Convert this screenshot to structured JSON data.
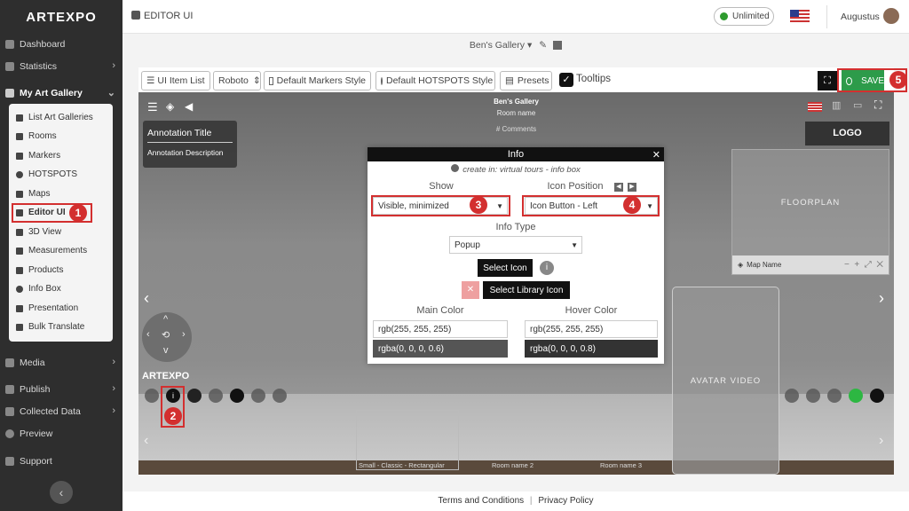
{
  "sidebar": {
    "logo": "ARTEXPO",
    "items": [
      {
        "label": "Dashboard",
        "icon": "dashboard-icon"
      },
      {
        "label": "Statistics",
        "icon": "chart-icon"
      },
      {
        "label": "My Art Gallery",
        "icon": "gallery-icon"
      },
      {
        "label": "Media",
        "icon": "media-icon"
      },
      {
        "label": "Publish",
        "icon": "publish-icon"
      },
      {
        "label": "Collected Data",
        "icon": "database-icon"
      },
      {
        "label": "Preview",
        "icon": "eye-icon"
      },
      {
        "label": "Support",
        "icon": "support-icon"
      }
    ],
    "subitems": [
      "List Art Galleries",
      "Rooms",
      "Markers",
      "HOTSPOTS",
      "Maps",
      "Editor UI",
      "3D View",
      "Measurements",
      "Products",
      "Info Box",
      "Presentation",
      "Bulk Translate"
    ]
  },
  "header": {
    "title": "EDITOR UI",
    "status": "Unlimited",
    "user": "Augustus",
    "status_color": "#2e9b2e"
  },
  "subheader": {
    "gallery": "Ben's Gallery"
  },
  "toolbar": {
    "ui_item_list": "UI Item List",
    "font": "Roboto",
    "markers_style": "Default Markers Style",
    "hotspots_style": "Default HOTSPOTS Style",
    "presets": "Presets",
    "tooltips": "Tooltips",
    "save": "SAVE"
  },
  "viewer": {
    "gallery_name": "Ben's Gallery",
    "room_name": "Room name",
    "comments": "# Comments",
    "annotation_title": "Annotation Title",
    "annotation_desc": "Annotation Description",
    "logo": "LOGO",
    "floorplan": "FLOORPLAN",
    "map_name": "Map Name",
    "avatar_video": "AVATAR VIDEO",
    "brand": "ARTEXPO",
    "rooms": [
      "Small - Classic - Rectangular",
      "Room name 2",
      "Room name 3"
    ]
  },
  "dialog": {
    "title": "Info",
    "hint": "create in: virtual tours - info box",
    "show_label": "Show",
    "show_value": "Visible, minimized",
    "icon_pos_label": "Icon Position",
    "icon_pos_value": "Icon Button - Left",
    "info_type_label": "Info Type",
    "info_type_value": "Popup",
    "select_icon": "Select Icon",
    "select_library_icon": "Select Library Icon",
    "main_color_label": "Main Color",
    "hover_color_label": "Hover Color",
    "main_color_1": "rgb(255, 255, 255)",
    "main_color_2": "rgba(0, 0, 0, 0.6)",
    "hover_color_1": "rgb(255, 255, 255)",
    "hover_color_2": "rgba(0, 0, 0, 0.8)"
  },
  "badges": [
    "1",
    "2",
    "3",
    "4",
    "5"
  ],
  "footer": {
    "terms": "Terms and Conditions",
    "sep": "|",
    "privacy": "Privacy Policy"
  }
}
